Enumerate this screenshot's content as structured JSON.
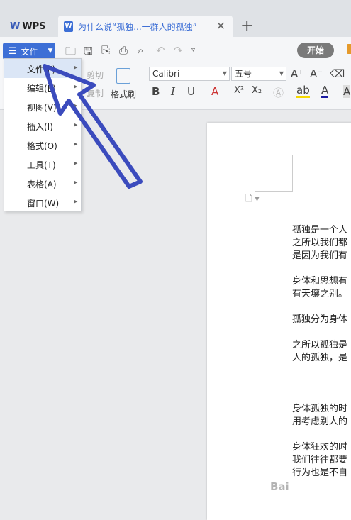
{
  "tabs": {
    "app_label": "WPS",
    "doc_title": "为什么说“孤独...一群人的孤独”",
    "close_glyph": "✕",
    "add_glyph": "+"
  },
  "toolbar": {
    "file_label": "文件",
    "start_tab": "开始"
  },
  "ribbon": {
    "cut_label": "剪切",
    "copy_label": "复制",
    "format_brush_label": "格式刷",
    "font_name": "Calibri",
    "font_size": "五号",
    "bold": "B",
    "italic": "I",
    "underline": "U",
    "strike": "A",
    "superscript": "X²",
    "subscript": "X₂",
    "grow_font": "A⁺",
    "shrink_font": "A⁻"
  },
  "menu": {
    "items": [
      {
        "label": "文件(F)"
      },
      {
        "label": "编辑(E)"
      },
      {
        "label": "视图(V)"
      },
      {
        "label": "插入(I)"
      },
      {
        "label": "格式(O)"
      },
      {
        "label": "工具(T)"
      },
      {
        "label": "表格(A)"
      },
      {
        "label": "窗口(W)"
      }
    ]
  },
  "document": {
    "lines": [
      "孤独是一个人",
      "之所以我们都",
      "是因为我们有",
      "",
      "身体和思想有",
      "有天壤之别。",
      "",
      "孤独分为身体",
      "",
      "之所以孤独是",
      "人的孤独，是",
      "",
      "",
      "",
      "身体孤独的时",
      "用考虑别人的",
      "",
      "身体狂欢的时",
      "我们往往都要",
      "行为也是不自"
    ]
  },
  "watermark": "Bai",
  "colors": {
    "accent": "#3d6fd6",
    "annotation_arrow": "#3b4bbd"
  }
}
